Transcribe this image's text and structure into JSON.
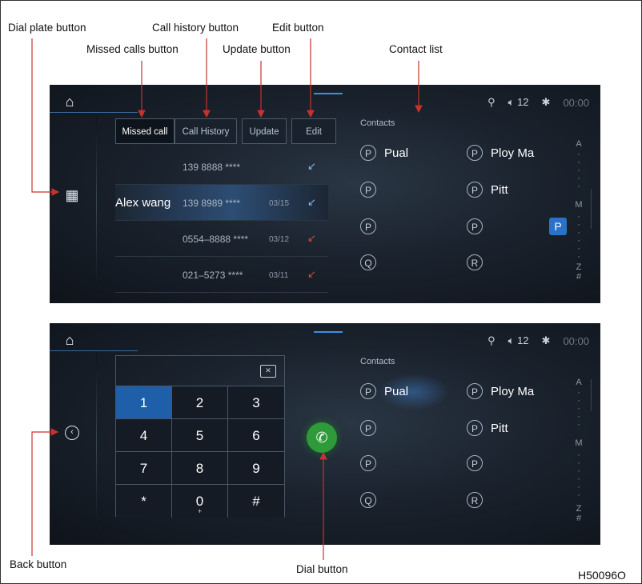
{
  "callouts": {
    "dial_plate": "Dial plate button",
    "missed_calls": "Missed calls button",
    "call_history": "Call history button",
    "update": "Update button",
    "edit": "Edit button",
    "contact_list": "Contact list",
    "back": "Back button",
    "dial": "Dial button"
  },
  "figure_code": "H50096O",
  "status_bar": {
    "volume": "12",
    "time": "00:00"
  },
  "tabs": {
    "missed": "Missed call",
    "history": "Call History",
    "update": "Update",
    "edit": "Edit"
  },
  "calls": [
    {
      "name": "",
      "number": "139 8888 ****",
      "date": "",
      "icon": "incoming-call-icon",
      "icon_color": "#8fb7e8"
    },
    {
      "name": "Alex wang",
      "number": "139 8989 ****",
      "date": "03/15",
      "icon": "incoming-call-icon",
      "icon_color": "#8fb7e8"
    },
    {
      "name": "",
      "number": "0554–8888 ****",
      "date": "03/12",
      "icon": "missed-call-icon",
      "icon_color": "#e2453a"
    },
    {
      "name": "",
      "number": "021–5273 ****",
      "date": "03/11",
      "icon": "missed-call-icon",
      "icon_color": "#e2453a"
    }
  ],
  "contacts": {
    "title": "Contacts",
    "left": [
      {
        "letter": "P",
        "name": "Pual"
      },
      {
        "letter": "P",
        "name": ""
      },
      {
        "letter": "P",
        "name": ""
      },
      {
        "letter": "Q",
        "name": ""
      }
    ],
    "right": [
      {
        "letter": "P",
        "name": "Ploy Ma"
      },
      {
        "letter": "P",
        "name": "Pitt"
      },
      {
        "letter": "P",
        "name": ""
      },
      {
        "letter": "R",
        "name": ""
      }
    ]
  },
  "az_index": {
    "a": "A",
    "m": "M",
    "z": "Z",
    "hash": "#",
    "current": "P"
  },
  "keypad": {
    "keys": [
      "1",
      "2",
      "3",
      "4",
      "5",
      "6",
      "7",
      "8",
      "9",
      "*",
      "0",
      "#"
    ],
    "zero_sub": "+"
  }
}
